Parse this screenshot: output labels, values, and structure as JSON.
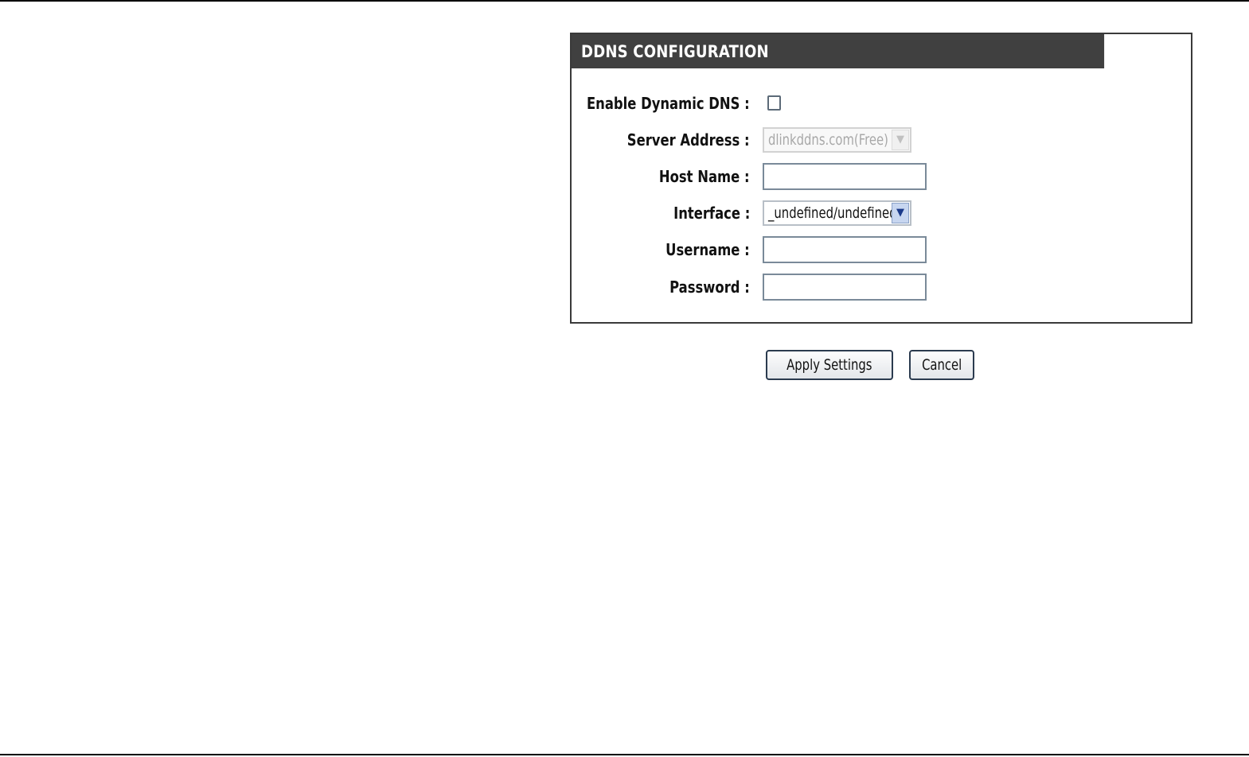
{
  "panel": {
    "title": "DDNS CONFIGURATION"
  },
  "fields": {
    "enable_ddns": {
      "label": "Enable Dynamic DNS :",
      "checked": false
    },
    "server_address": {
      "label": "Server Address :",
      "value": "dlinkddns.com(Free)",
      "disabled": true
    },
    "host_name": {
      "label": "Host Name :",
      "value": ""
    },
    "interface": {
      "label": "Interface :",
      "value": "_undefined/undefined"
    },
    "username": {
      "label": "Username  :",
      "value": ""
    },
    "password": {
      "label": "Password  :",
      "value": ""
    }
  },
  "buttons": {
    "apply": "Apply Settings",
    "cancel": "Cancel"
  },
  "icons": {
    "dropdown_arrow": "chevron-down-icon"
  }
}
